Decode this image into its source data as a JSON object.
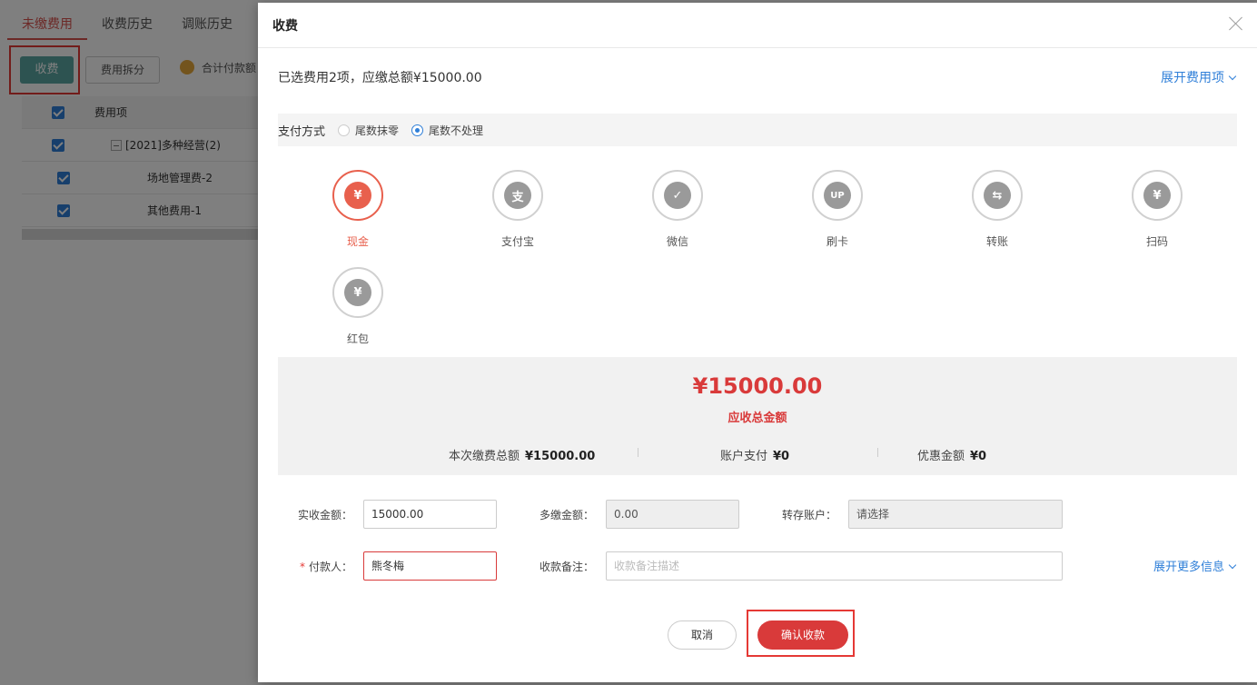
{
  "background": {
    "tabs": [
      "未缴费用",
      "收费历史",
      "调账历史"
    ],
    "collect_button": "收费",
    "split_button": "费用拆分",
    "sum_info": "合计付款额",
    "table": {
      "header": "费用项",
      "rows": [
        "[2021]多种经营(2)",
        "场地管理费-2",
        "其他费用-1"
      ]
    }
  },
  "modal": {
    "title": "收费",
    "summary": "已选费用2项，应缴总额¥15000.00",
    "expand_fee_items": "展开费用项",
    "payment_method": {
      "label": "支付方式",
      "options": [
        "尾数抹零",
        "尾数不处理"
      ],
      "selected": "尾数不处理"
    },
    "methods": [
      {
        "label": "现金",
        "icon": "cash-bag-icon",
        "glyph": "¥"
      },
      {
        "label": "支付宝",
        "icon": "alipay-icon",
        "glyph": "支"
      },
      {
        "label": "微信",
        "icon": "wechat-icon",
        "glyph": "✓"
      },
      {
        "label": "刷卡",
        "icon": "unionpay-card-icon",
        "glyph": "UP"
      },
      {
        "label": "转账",
        "icon": "transfer-icon",
        "glyph": "⇆"
      },
      {
        "label": "扫码",
        "icon": "scan-bag-icon",
        "glyph": "¥"
      },
      {
        "label": "红包",
        "icon": "red-envelope-bag-icon",
        "glyph": "¥"
      }
    ],
    "selected_method": "现金",
    "amount": {
      "total": "¥15000.00",
      "total_label": "应收总金额",
      "this_payment_label": "本次缴费总额",
      "this_payment_value": "¥15000.00",
      "account_pay_label": "账户支付",
      "account_pay_value": "¥0",
      "discount_label": "优惠金额",
      "discount_value": "¥0"
    },
    "form": {
      "received_label": "实收金额：",
      "received_value": "15000.00",
      "overpay_label": "多缴金额：",
      "overpay_value": "0.00",
      "transfer_account_label": "转存账户：",
      "transfer_account_placeholder": "请选择",
      "payer_label": "付款人：",
      "payer_value": "熊冬梅",
      "remark_label": "收款备注：",
      "remark_placeholder": "收款备注描述",
      "expand_more": "展开更多信息"
    },
    "buttons": {
      "cancel": "取消",
      "confirm": "确认收款"
    }
  },
  "colors": {
    "accent_red": "#d93a3a",
    "link_blue": "#2f7fd8",
    "teal_button": "#5aa7a3"
  }
}
